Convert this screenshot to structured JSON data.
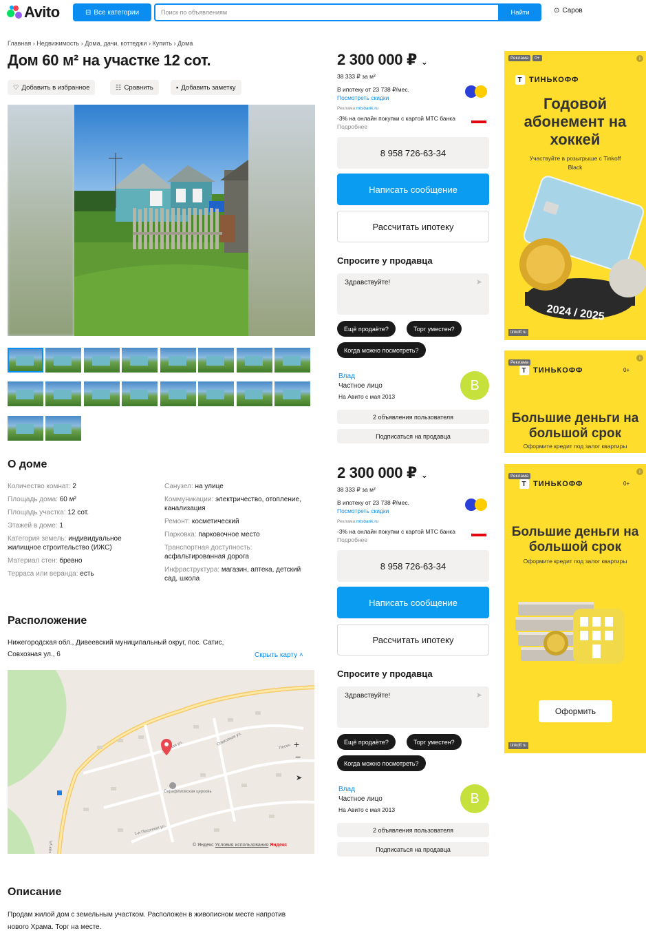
{
  "header": {
    "logo": "Avito",
    "categories_button": "Все категории",
    "search_placeholder": "Поиск по объявлениям",
    "search_button": "Найти",
    "location": "Саров"
  },
  "breadcrumb": [
    "Главная",
    "Недвижимость",
    "Дома, дачи, коттеджи",
    "Купить",
    "Дома"
  ],
  "title": "Дом 60 м² на участке 12 сот.",
  "title_actions": {
    "favorite": "Добавить в избранное",
    "compare": "Сравнить",
    "note": "Добавить заметку"
  },
  "about": {
    "heading": "О доме",
    "left": [
      {
        "k": "Количество комнат: ",
        "v": "2"
      },
      {
        "k": "Площадь дома: ",
        "v": "60 м²"
      },
      {
        "k": "Площадь участка: ",
        "v": "12 сот."
      },
      {
        "k": "Этажей в доме: ",
        "v": "1"
      },
      {
        "k": "Категория земель: ",
        "v": "индивидуальное жилищное строительство (ИЖС)"
      },
      {
        "k": "Материал стен: ",
        "v": "бревно"
      },
      {
        "k": "Терраса или веранда: ",
        "v": "есть"
      }
    ],
    "right": [
      {
        "k": "Санузел: ",
        "v": "на улице"
      },
      {
        "k": "Коммуникации: ",
        "v": "электричество, отопление, канализация"
      },
      {
        "k": "Ремонт: ",
        "v": "косметический"
      },
      {
        "k": "Парковка: ",
        "v": "парковочное место"
      },
      {
        "k": "Транспортная доступность: ",
        "v": "асфальтированная дорога"
      },
      {
        "k": "Инфраструктура: ",
        "v": "магазин, аптека, детский сад, школа"
      }
    ]
  },
  "location": {
    "heading": "Расположение",
    "address": "Нижегородская обл., Дивеевский муниципальный округ, пос. Сатис, Совхозная ул., 6",
    "toggle": "Скрыть карту",
    "map_labels": {
      "church": "Серафимовская церковь",
      "st1": "Зелёная ул.",
      "st2": "Совхозная ул.",
      "st3": "1-я Песочная ул.",
      "st4": "Песоч",
      "st5": "кая ул."
    },
    "copyright": "© Яндекс",
    "terms": "Условия использования",
    "yandex": "Яндекс"
  },
  "description": {
    "heading": "Описание",
    "text": "Продам жилой дом с земельным участком. Расположен в живописном месте напротив нового Храма. Торг на месте."
  },
  "seller_block": {
    "price": "2 300 000 ₽",
    "per_m2": "38 333 ₽ за м²",
    "mortgage": "В ипотеку от 23 738 ₽/мес.",
    "discounts": "Посмотреть скидки",
    "ad_label": "Реклама",
    "ad_site": "mtsbank.ru",
    "ad_text": "-3% на онлайн покупки с картой МТС банка",
    "ad_more": "Подробнее",
    "phone": "8 958 726-63-34",
    "write": "Написать сообщение",
    "calc": "Рассчитать ипотеку",
    "ask_heading": "Спросите у продавца",
    "msg_placeholder": "Здравствуйте!",
    "chips": [
      "Ещё продаёте?",
      "Торг уместен?",
      "Когда можно посмотреть?"
    ],
    "seller_name": "Влад",
    "seller_type": "Частное лицо",
    "seller_since": "На Авито с мая 2013",
    "avatar_letter": "В",
    "user_ads": "2 объявления пользователя",
    "subscribe": "Подписаться на продавца"
  },
  "ads": {
    "tag": "Реклама",
    "age": "0+",
    "brand": "ТИНЬКОФФ",
    "ad1_head": "Годовой абонемент на хоккей",
    "ad1_sub": "Участвуйте в розыгрыше с Tinkoff Black",
    "ad1_season": "2024 / 2025",
    "ad_url": "tinkoff.ru",
    "ad2_head": "Большие деньги на большой срок",
    "ad2_sub": "Оформите кредит под залог квартиры",
    "ad3_btn": "Оформить"
  },
  "colors": {
    "accent": "#0a8cf0",
    "ad_yellow": "#ffdd2d",
    "avatar": "#c6e03c"
  }
}
